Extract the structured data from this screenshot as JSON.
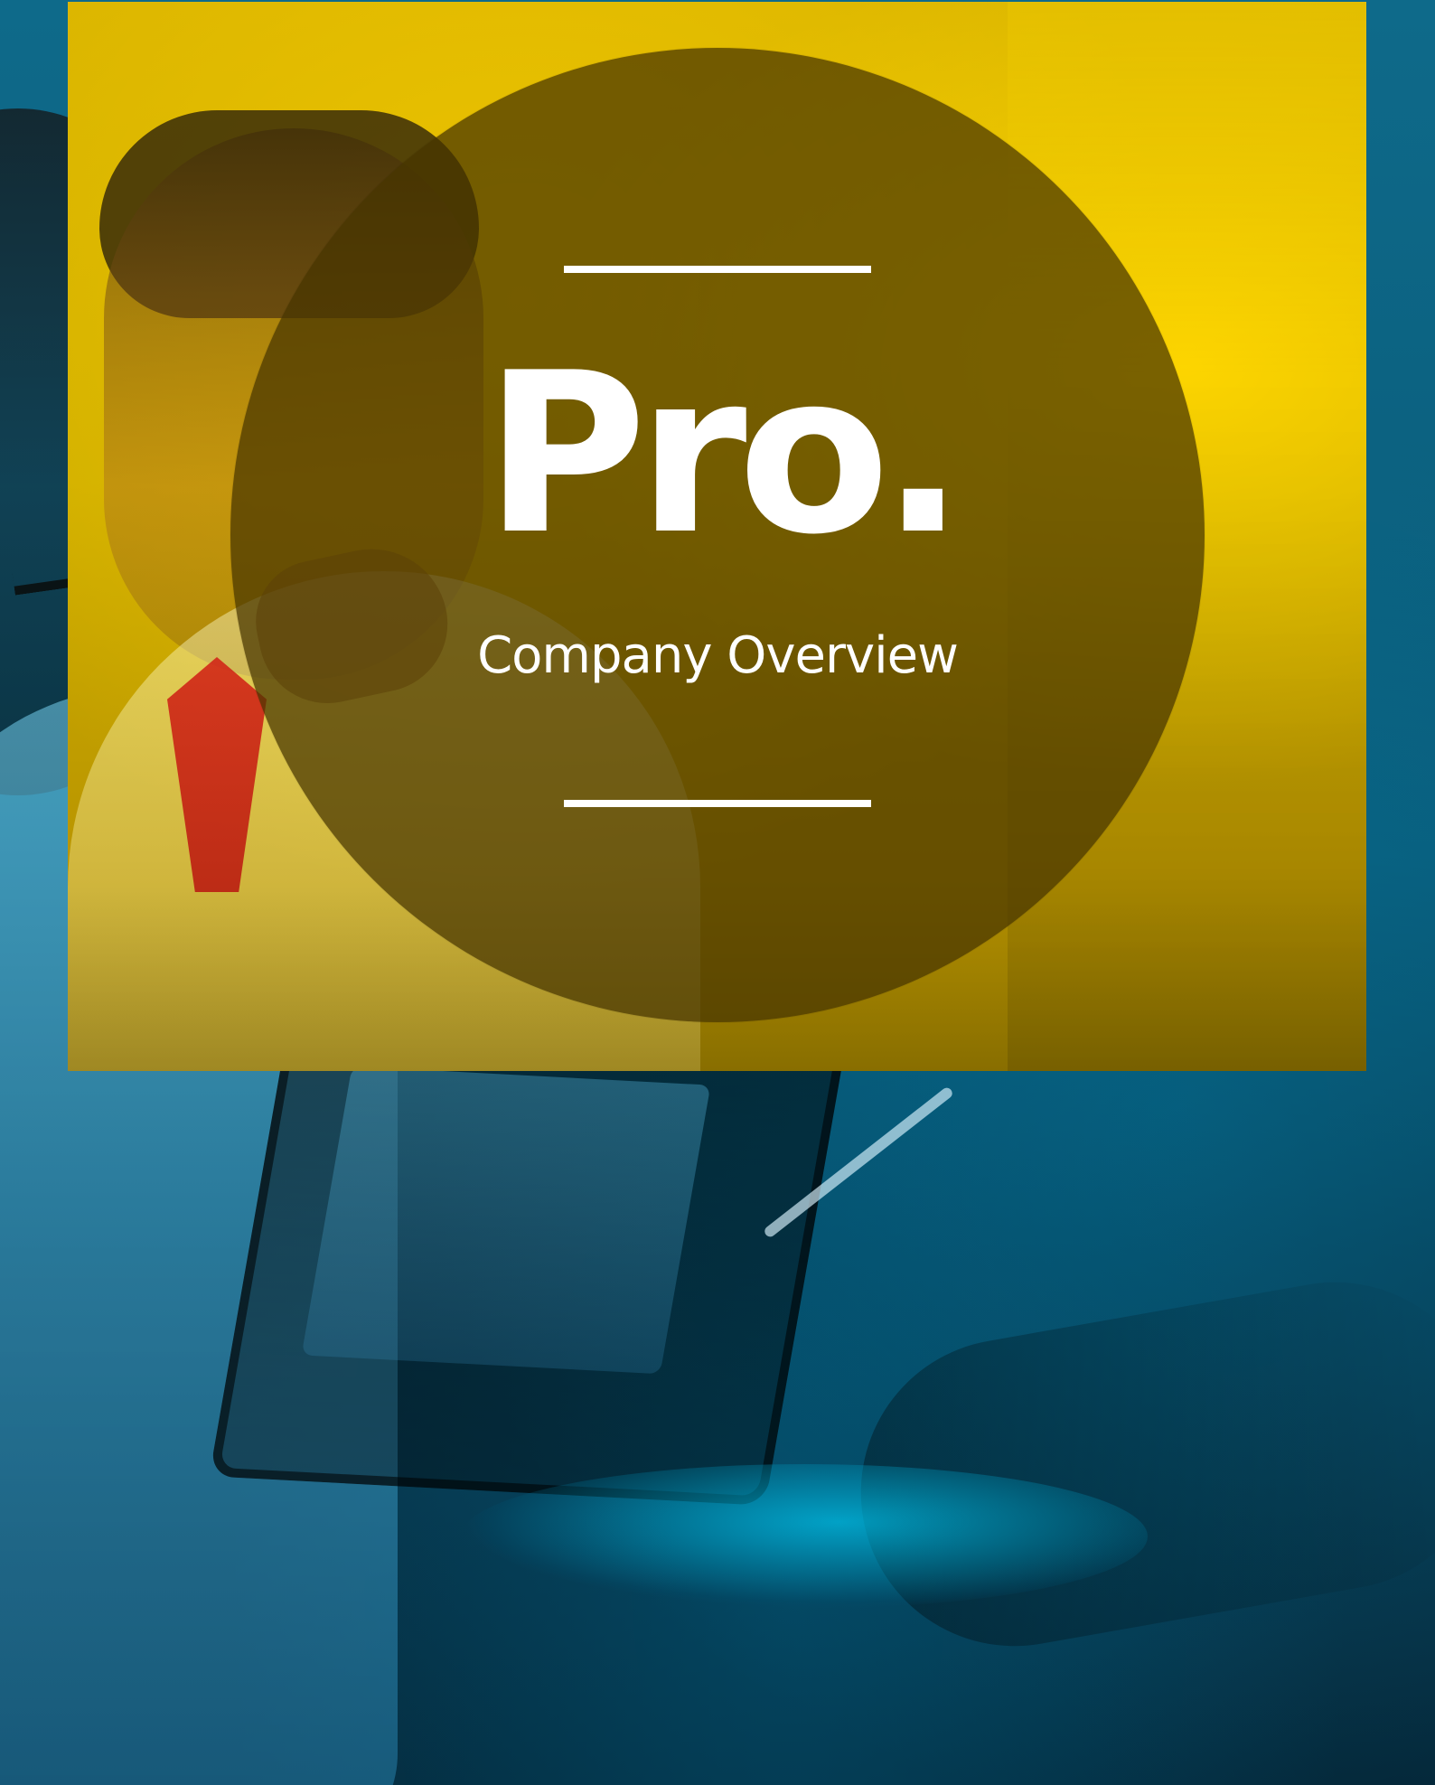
{
  "cover": {
    "title": "Pro.",
    "subtitle": "Company Overview"
  },
  "colors": {
    "accent_yellow": "#CFAE00",
    "circle_overlay": "#463400",
    "teal_background": "#0A5A78",
    "text": "#FFFFFF"
  }
}
